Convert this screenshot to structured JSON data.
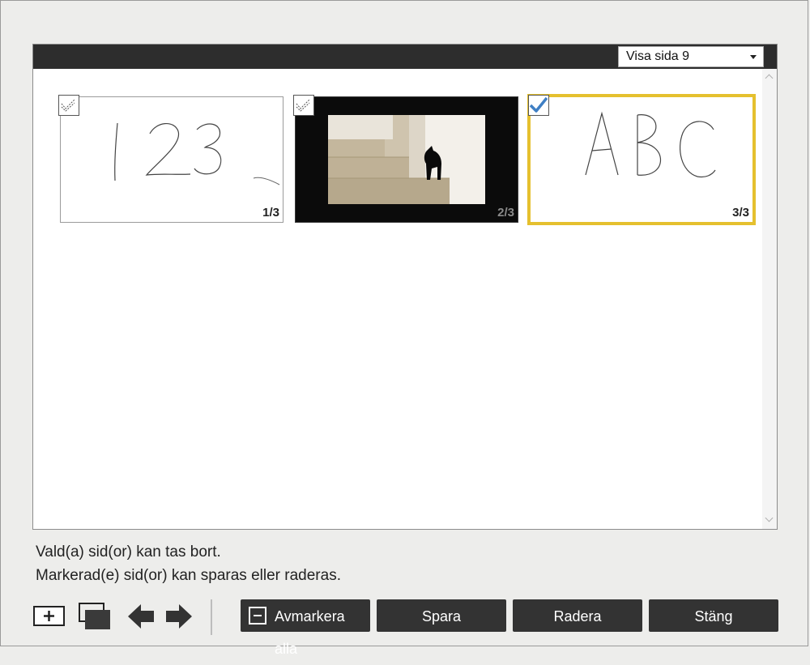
{
  "header": {
    "page_select": {
      "selected": "Visa sida 9"
    }
  },
  "thumbnails": [
    {
      "name": "thumbnail-page-1",
      "page_label": "1/3",
      "content_text": "123",
      "selected": false,
      "checked": false
    },
    {
      "name": "thumbnail-page-2",
      "page_label": "2/3",
      "content": "photo of black cat on stairs",
      "selected": false,
      "checked": false
    },
    {
      "name": "thumbnail-page-3",
      "page_label": "3/3",
      "content_text": "ABC",
      "selected": true,
      "checked": true
    }
  ],
  "status": {
    "line1": "Vald(a) sid(or) kan tas bort.",
    "line2": "Markerad(e) sid(or) kan sparas eller raderas."
  },
  "toolbar": {
    "icons": [
      "add-page-icon",
      "duplicate-page-icon",
      "arrow-left-icon",
      "arrow-right-icon"
    ],
    "deselect_all_label": "Avmarkera alla",
    "save_label": "Spara",
    "delete_label": "Radera",
    "close_label": "Stäng"
  },
  "colors": {
    "selected_border": "#e5c02e",
    "check_blue": "#3f7fc4",
    "button_bg": "#333333",
    "header_bg": "#2d2d2d"
  }
}
